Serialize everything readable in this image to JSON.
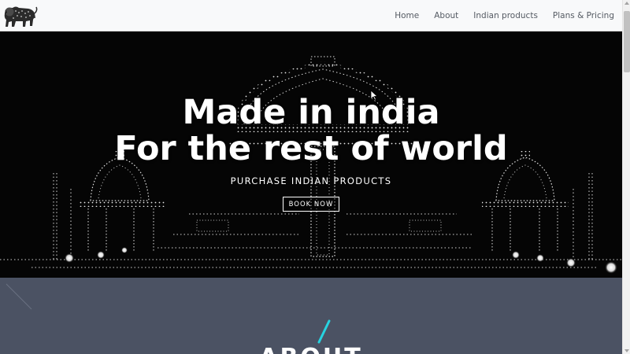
{
  "navbar": {
    "brand_icon": "lion-logo-icon",
    "links": [
      "Home",
      "About",
      "Indian products",
      "Plans & Pricing"
    ]
  },
  "hero": {
    "title_line1": "Made in india",
    "title_line2": "For the rest of world",
    "subtitle": "PURCHASE INDIAN PRODUCTS",
    "button_label": "BOOK NOW"
  },
  "about": {
    "heading": "ABOUT",
    "accent_color": "#27d3e0",
    "background_color": "#4b5263"
  },
  "colors": {
    "navbar_bg": "#f8f9fa",
    "nav_text": "#555b63",
    "hero_bg": "#050505"
  }
}
